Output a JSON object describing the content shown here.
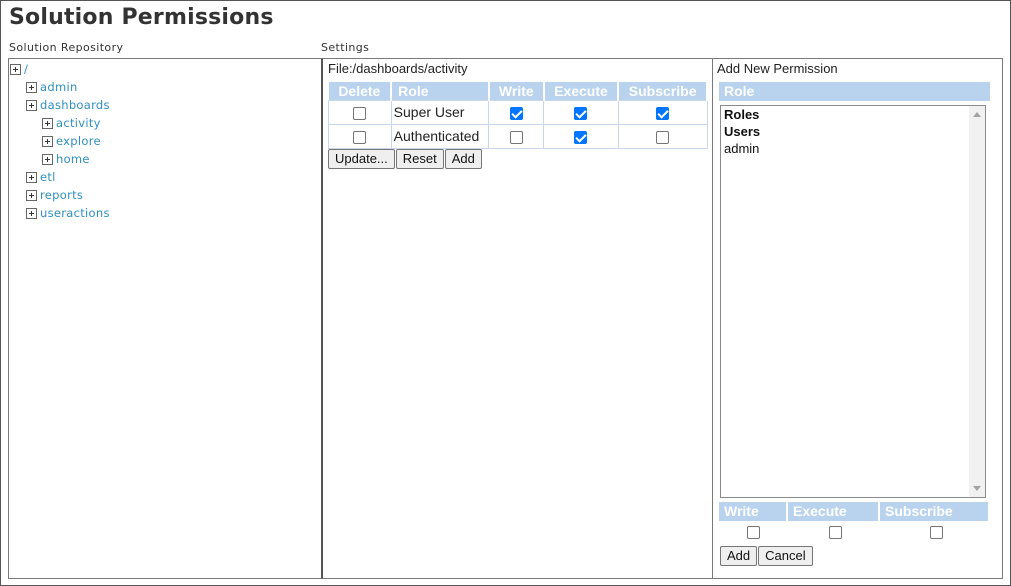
{
  "page": {
    "title": "Solution Permissions",
    "repository_label": "Solution Repository",
    "settings_label": "Settings"
  },
  "tree": {
    "root": "/",
    "items": [
      {
        "label": "admin",
        "level": 1
      },
      {
        "label": "dashboards",
        "level": 1
      },
      {
        "label": "activity",
        "level": 2
      },
      {
        "label": "explore",
        "level": 2
      },
      {
        "label": "home",
        "level": 2
      },
      {
        "label": "etl",
        "level": 1
      },
      {
        "label": "reports",
        "level": 1
      },
      {
        "label": "useractions",
        "level": 1
      }
    ]
  },
  "settings": {
    "file_path": "File:/dashboards/activity",
    "columns": {
      "delete": "Delete",
      "role": "Role",
      "write": "Write",
      "execute": "Execute",
      "subscribe": "Subscribe"
    },
    "rows": [
      {
        "role": "Super User",
        "delete": false,
        "write": true,
        "execute": true,
        "subscribe": true
      },
      {
        "role": "Authenticated",
        "delete": false,
        "write": false,
        "execute": true,
        "subscribe": false
      }
    ],
    "buttons": {
      "update": "Update...",
      "reset": "Reset",
      "add": "Add"
    }
  },
  "add_permission": {
    "title": "Add New Permission",
    "role_header": "Role",
    "roles": [
      {
        "label": "Roles",
        "group": true
      },
      {
        "label": "Users",
        "group": true
      },
      {
        "label": "admin",
        "group": false
      }
    ],
    "permission_headers": {
      "write": "Write",
      "execute": "Execute",
      "subscribe": "Subscribe"
    },
    "permissions": {
      "write": false,
      "execute": false,
      "subscribe": false
    },
    "buttons": {
      "add": "Add",
      "cancel": "Cancel"
    }
  },
  "colors": {
    "header_bg": "#b9d3ef",
    "tree_link": "#2f8fbf",
    "checkbox_on": "#0075ff"
  }
}
